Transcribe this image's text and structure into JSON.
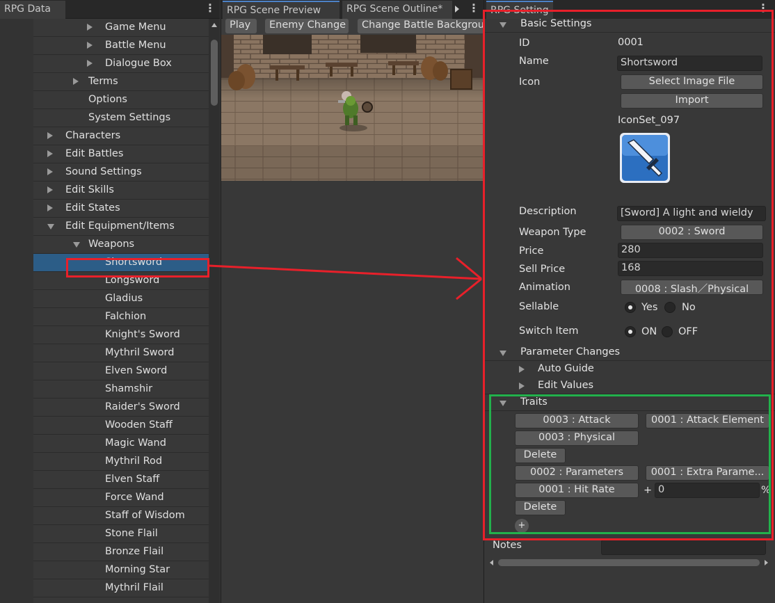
{
  "left": {
    "tab": "RPG Data",
    "tree": [
      {
        "label": "Game Menu",
        "indent": 3,
        "arrow": "right"
      },
      {
        "label": "Battle Menu",
        "indent": 3,
        "arrow": "right"
      },
      {
        "label": "Dialogue Box",
        "indent": 3,
        "arrow": "right"
      },
      {
        "label": "Terms",
        "indent": 2,
        "arrow": "right"
      },
      {
        "label": "Options",
        "indent": 2,
        "arrow": "none"
      },
      {
        "label": "System Settings",
        "indent": 2,
        "arrow": "none"
      },
      {
        "label": "Characters",
        "indent": 1,
        "arrow": "right"
      },
      {
        "label": "Edit Battles",
        "indent": 1,
        "arrow": "right"
      },
      {
        "label": "Sound Settings",
        "indent": 1,
        "arrow": "right"
      },
      {
        "label": "Edit Skills",
        "indent": 1,
        "arrow": "right"
      },
      {
        "label": "Edit States",
        "indent": 1,
        "arrow": "right"
      },
      {
        "label": "Edit Equipment/Items",
        "indent": 1,
        "arrow": "down"
      },
      {
        "label": "Weapons",
        "indent": 2,
        "arrow": "down"
      },
      {
        "label": "Shortsword",
        "indent": 3,
        "arrow": "none",
        "selected": true
      },
      {
        "label": "Longsword",
        "indent": 3,
        "arrow": "none"
      },
      {
        "label": "Gladius",
        "indent": 3,
        "arrow": "none"
      },
      {
        "label": "Falchion",
        "indent": 3,
        "arrow": "none"
      },
      {
        "label": "Knight's Sword",
        "indent": 3,
        "arrow": "none"
      },
      {
        "label": "Mythril Sword",
        "indent": 3,
        "arrow": "none"
      },
      {
        "label": "Elven Sword",
        "indent": 3,
        "arrow": "none"
      },
      {
        "label": "Shamshir",
        "indent": 3,
        "arrow": "none"
      },
      {
        "label": "Raider's Sword",
        "indent": 3,
        "arrow": "none"
      },
      {
        "label": "Wooden Staff",
        "indent": 3,
        "arrow": "none"
      },
      {
        "label": "Magic Wand",
        "indent": 3,
        "arrow": "none"
      },
      {
        "label": "Mythril Rod",
        "indent": 3,
        "arrow": "none"
      },
      {
        "label": "Elven Staff",
        "indent": 3,
        "arrow": "none"
      },
      {
        "label": "Force Wand",
        "indent": 3,
        "arrow": "none"
      },
      {
        "label": "Staff of Wisdom",
        "indent": 3,
        "arrow": "none"
      },
      {
        "label": "Stone Flail",
        "indent": 3,
        "arrow": "none"
      },
      {
        "label": "Bronze Flail",
        "indent": 3,
        "arrow": "none"
      },
      {
        "label": "Morning Star",
        "indent": 3,
        "arrow": "none"
      },
      {
        "label": "Mythril Flail",
        "indent": 3,
        "arrow": "none"
      }
    ]
  },
  "middle": {
    "tabs": [
      "RPG Scene Preview",
      "RPG Scene Outline*"
    ],
    "toolbar": {
      "play": "Play",
      "enemy_change": "Enemy Change",
      "change_bg": "Change Battle Backgrou"
    }
  },
  "right": {
    "tab": "RPG Setting",
    "basic": {
      "header": "Basic Settings",
      "id_label": "ID",
      "id_value": "0001",
      "name_label": "Name",
      "name_value": "Shortsword",
      "icon_label": "Icon",
      "select_image": "Select Image File",
      "import": "Import",
      "icon_name": "IconSet_097",
      "description_label": "Description",
      "description_value": "[Sword] A light and wieldy",
      "weapon_type_label": "Weapon Type",
      "weapon_type_value": "0002 : Sword",
      "price_label": "Price",
      "price_value": "280",
      "sell_price_label": "Sell Price",
      "sell_price_value": "168",
      "animation_label": "Animation",
      "animation_value": "0008 : Slash／Physical",
      "sellable_label": "Sellable",
      "sellable_yes": "Yes",
      "sellable_no": "No",
      "switch_label": "Switch Item",
      "switch_on": "ON",
      "switch_off": "OFF"
    },
    "params": {
      "header": "Parameter Changes",
      "auto_guide": "Auto Guide",
      "edit_values": "Edit Values"
    },
    "traits": {
      "header": "Traits",
      "t1_a": "0003 : Attack",
      "t1_b": "0001 : Attack Element",
      "t1_c": "0003 : Physical",
      "t1_delete": "Delete",
      "t2_a": "0002 : Parameters",
      "t2_b": "0001 : Extra Parame...",
      "t2_c": "0001 : Hit Rate",
      "t2_plus": "+",
      "t2_value": "0",
      "t2_unit": "%",
      "t2_delete": "Delete",
      "add": "+"
    },
    "notes_label": "Notes"
  },
  "colors": {
    "selection": "#2c5d87",
    "annotation_red": "#e8202a",
    "annotation_green": "#22b14c"
  }
}
